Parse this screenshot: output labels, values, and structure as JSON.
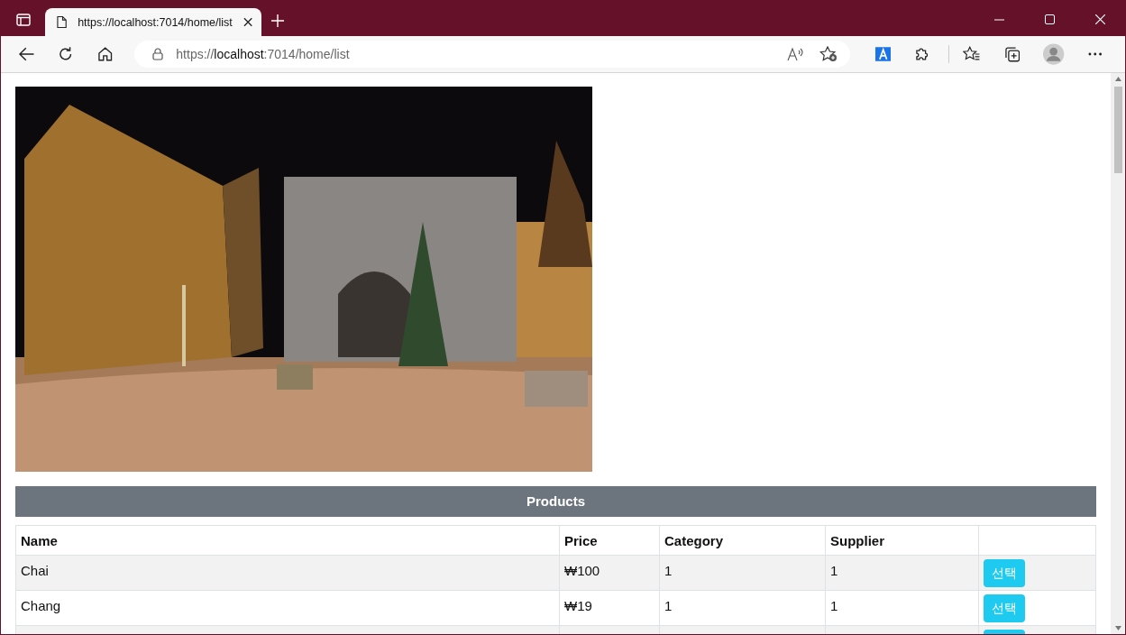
{
  "browser": {
    "tab": {
      "title": "https://localhost:7014/home/list",
      "selected": true
    },
    "address": {
      "scheme": "https://",
      "host": "localhost",
      "path": ":7014/home/list"
    }
  },
  "page": {
    "table": {
      "caption": "Products",
      "columns": [
        "Name",
        "Price",
        "Category",
        "Supplier"
      ],
      "rows": [
        {
          "cells": [
            "Chai",
            "₩100",
            "1",
            "1"
          ],
          "action": "선택"
        },
        {
          "cells": [
            "Chang",
            "₩19",
            "1",
            "1"
          ],
          "action": "선택"
        }
      ]
    }
  }
}
